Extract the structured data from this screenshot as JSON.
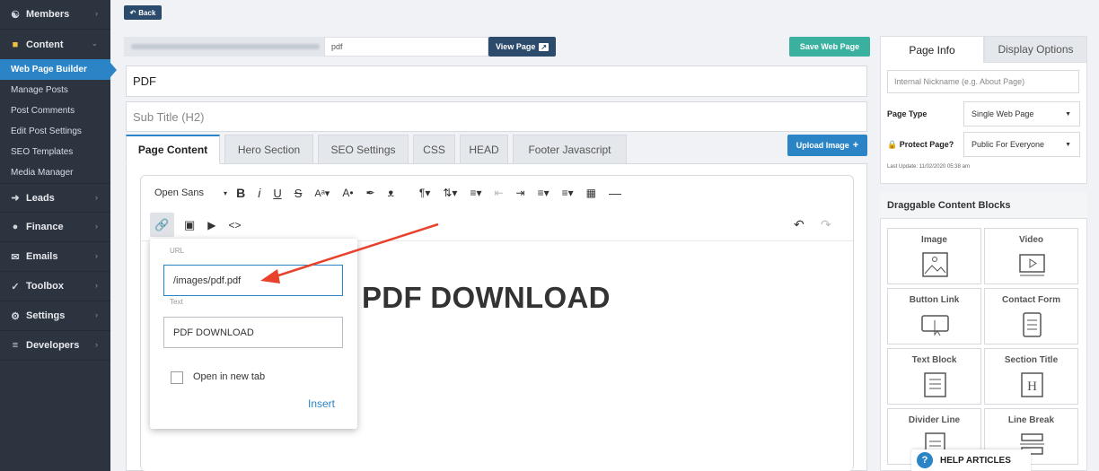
{
  "sidebar": {
    "items": [
      {
        "label": "Members",
        "icon": "users-icon"
      },
      {
        "label": "Content",
        "icon": "folder-icon"
      },
      {
        "label": "Leads",
        "icon": "share-icon"
      },
      {
        "label": "Finance",
        "icon": "finance-icon"
      },
      {
        "label": "Emails",
        "icon": "envelope-icon"
      },
      {
        "label": "Toolbox",
        "icon": "wrench-icon"
      },
      {
        "label": "Settings",
        "icon": "gear-icon"
      },
      {
        "label": "Developers",
        "icon": "sliders-icon"
      }
    ],
    "content_sub": [
      "Web Page Builder",
      "Manage Posts",
      "Post Comments",
      "Edit Post Settings",
      "SEO Templates",
      "Media Manager"
    ]
  },
  "toolbar": {
    "back_label": "Back",
    "slug_value": "pdf",
    "view_page_label": "View Page",
    "save_label": "Save Web Page",
    "upload_label": "Upload Image"
  },
  "page": {
    "title_value": "PDF",
    "subtitle_placeholder": "Sub Title (H2)"
  },
  "tabs": [
    "Page Content",
    "Hero Section",
    "SEO Settings",
    "CSS",
    "HEAD",
    "Footer Javascript"
  ],
  "editor": {
    "font_name": "Open Sans",
    "heading_text": "PDF DOWNLOAD"
  },
  "link_popup": {
    "url_label": "URL",
    "url_value": "/images/pdf.pdf",
    "text_label": "Text",
    "text_value": "PDF DOWNLOAD",
    "new_tab_label": "Open in new tab",
    "insert_label": "Insert"
  },
  "right_panel": {
    "tabs": [
      "Page Info",
      "Display Options"
    ],
    "nickname_placeholder": "Internal Nickname (e.g. About Page)",
    "page_type_label": "Page Type",
    "page_type_value": "Single Web Page",
    "protect_label": "Protect Page?",
    "protect_value": "Public For Everyone",
    "last_update": "Last Update: 11/02/2020 05:38 am",
    "blocks_title": "Draggable Content Blocks",
    "blocks": [
      "Image",
      "Video",
      "Button Link",
      "Contact Form",
      "Text Block",
      "Section Title",
      "Divider Line",
      "Line Break"
    ]
  },
  "help": {
    "label": "HELP ARTICLES"
  },
  "colors": {
    "accent": "#2b84c6",
    "sidebar": "#2c3440",
    "save": "#3ab09e",
    "arrow": "#e8412c"
  }
}
